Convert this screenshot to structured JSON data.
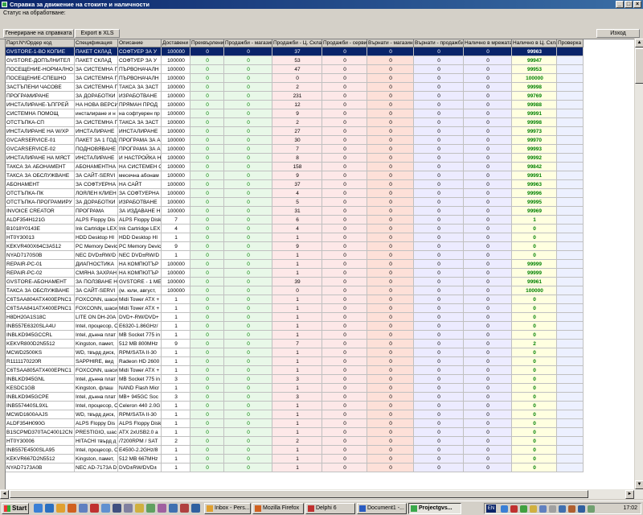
{
  "window": {
    "title": "Справка за движение на стоките и наличности",
    "status_label": "Статус на обработване:"
  },
  "toolbar": {
    "generate_label": "Генериране на справката",
    "export_label": "Export в XLS",
    "exit_label": "Изход"
  },
  "columns": [
    "Парт.N*/Ордер код",
    "Спецификация",
    "Описание",
    "Доставени",
    "Прехвърлени",
    "Продажби - магазини",
    "Продажби - Ц. Склад",
    "Продажби - сервиз",
    "Върнати - магазини",
    "Върнати - продажби",
    "Налично в мрежата",
    "Налично в Ц. Склад",
    "Проверка"
  ],
  "rows": [
    [
      "GVSTORE-1-ВО КОПИЕ",
      "ПАКЕТ СКЛАД",
      "СОФТУЕР ЗА У",
      "100000",
      "0",
      "0",
      "37",
      "0",
      "0",
      "0",
      "0",
      "99963",
      ""
    ],
    [
      "GVSTORE-ДОПЪЛНИТЕЛ",
      "ПАКЕТ СКЛАД",
      "СОФТУЕР ЗА У",
      "100000",
      "0",
      "0",
      "53",
      "0",
      "0",
      "0",
      "0",
      "99947",
      ""
    ],
    [
      "ПОСЕЩЕНИЕ-НОРМАЛНО",
      "ЗА СИСТЕМНА П",
      "ПЪРВОНАЧАЛН",
      "100000",
      "0",
      "0",
      "47",
      "0",
      "0",
      "0",
      "0",
      "99953",
      ""
    ],
    [
      "ПОСЕЩЕНИЕ-СПЕШНО",
      "ЗА СИСТЕМНА П",
      "ПЪРВОНАЧАЛН",
      "100000",
      "0",
      "0",
      "0",
      "0",
      "0",
      "0",
      "0",
      "100000",
      ""
    ],
    [
      "ЗАСТЪПЕНИ ЧАСОВЕ",
      "ЗА СИСТЕМНА П",
      "ТАКСА ЗА ЗАСТ",
      "100000",
      "0",
      "0",
      "2",
      "0",
      "0",
      "0",
      "0",
      "99998",
      ""
    ],
    [
      "ПРОГРАМИРАНЕ",
      "ЗА ДОРАБОТКИ",
      "ИЗРАБОТВАНЕ",
      "100000",
      "0",
      "0",
      "231",
      "0",
      "0",
      "0",
      "0",
      "99769",
      ""
    ],
    [
      "ИНСТАЛИРАНЕ-ЪПГРЕЙ",
      "НА НОВА ВЕРСИ",
      "ПРЯМАН ПРОД",
      "100000",
      "0",
      "0",
      "12",
      "0",
      "0",
      "0",
      "0",
      "99988",
      ""
    ],
    [
      "СИСТЕМНА ПОМОЩ",
      "инсталиране и н",
      "на софтуерен пр",
      "100000",
      "0",
      "0",
      "9",
      "0",
      "0",
      "0",
      "0",
      "99991",
      ""
    ],
    [
      "ОТСТЪПКА-СП",
      "ЗА СИСТЕМНА П",
      "ТАКСА ЗА ЗАСТ",
      "100000",
      "0",
      "0",
      "2",
      "0",
      "0",
      "0",
      "0",
      "99998",
      ""
    ],
    [
      "ИНСТАЛИРАНЕ НА W/XP",
      "ИНСТАЛИРАНЕ",
      "ИНСТАЛИРАНЕ",
      "100000",
      "0",
      "0",
      "27",
      "0",
      "0",
      "0",
      "0",
      "99973",
      ""
    ],
    [
      "GVCARSERVICE-01",
      "ПАКЕТ ЗА 1 ГОД",
      "ПРОГРАМА ЗА А",
      "100000",
      "0",
      "0",
      "30",
      "0",
      "0",
      "0",
      "0",
      "99970",
      ""
    ],
    [
      "GVCARSERVICE-02",
      "ПОДНОВЯВАНЕ",
      "ПРОГРАМА ЗА А",
      "100000",
      "0",
      "0",
      "7",
      "0",
      "0",
      "0",
      "0",
      "99993",
      ""
    ],
    [
      "ИНСТАЛИРАНЕ НА МЯСТ",
      "ИНСТАЛИРАНЕ",
      "И НАСТРОЙКА Н",
      "100000",
      "0",
      "0",
      "8",
      "0",
      "0",
      "0",
      "0",
      "99992",
      ""
    ],
    [
      "ТАКСА ЗА АБОНАМЕНТ",
      "АБОНАМЕНТНА",
      "НА СИСТЕМЕН С",
      "100000",
      "0",
      "0",
      "158",
      "0",
      "0",
      "0",
      "0",
      "99842",
      ""
    ],
    [
      "ТАКСА ЗА ОБСЛУЖВАНЕ",
      "ЗА САЙТ-SERVI",
      "месечна абонам",
      "100000",
      "0",
      "0",
      "9",
      "0",
      "0",
      "0",
      "0",
      "99991",
      ""
    ],
    [
      "АБОНАМЕНТ",
      "ЗА СОФТУЕРНА",
      "НА САЙТ",
      "100000",
      "0",
      "0",
      "37",
      "0",
      "0",
      "0",
      "0",
      "99963",
      ""
    ],
    [
      "ОТСТЪПКА-ПК",
      "ЛОЯЛЕН КЛИЕН",
      "ЗА СОФТУЕРНА",
      "100000",
      "0",
      "0",
      "4",
      "0",
      "0",
      "0",
      "0",
      "99996",
      ""
    ],
    [
      "ОТСТЪПКА-ПРОГРАМИРУ",
      "ЗА ДОРАБОТКИ",
      "ИЗРАБОТВАНЕ",
      "100000",
      "0",
      "0",
      "5",
      "0",
      "0",
      "0",
      "0",
      "99995",
      ""
    ],
    [
      "INVOICE CREATOR",
      "ПРОГРАМА",
      "ЗА ИЗДАВАНЕ Н",
      "100000",
      "0",
      "0",
      "31",
      "0",
      "0",
      "0",
      "0",
      "99969",
      ""
    ],
    [
      "ALDF354H121G",
      "ALPS Floppy Dis",
      "ALPS Floppy Disk",
      "7",
      "0",
      "0",
      "6",
      "0",
      "0",
      "0",
      "0",
      "1",
      ""
    ],
    [
      "B1018Y0143E",
      "Ink Cartridge LEX",
      "Ink Cartridge LEX",
      "4",
      "0",
      "0",
      "4",
      "0",
      "0",
      "0",
      "0",
      "0",
      ""
    ],
    [
      "HT0Y30013",
      "HDD Desktop HI",
      "HDD Desktop HI",
      "1",
      "0",
      "0",
      "1",
      "0",
      "0",
      "0",
      "0",
      "0",
      ""
    ],
    [
      "KEKVR400X64C3A512",
      "PC Memory Devic",
      "PC Memory Devic",
      "9",
      "0",
      "0",
      "9",
      "0",
      "0",
      "0",
      "0",
      "0",
      ""
    ],
    [
      "NYAD7170S0B",
      "NEC DVD±RW/D",
      "NEC DVD±RW/D",
      "1",
      "0",
      "0",
      "1",
      "0",
      "0",
      "0",
      "0",
      "0",
      ""
    ],
    [
      "REPAIR-PC-01",
      "ДИАГНОСТИКА",
      "НА КОМПЮТЪР",
      "100000",
      "0",
      "0",
      "1",
      "0",
      "0",
      "0",
      "0",
      "99999",
      ""
    ],
    [
      "REPAIR-PC-02",
      "СМЯНА ЗАХРАН",
      "НА КОМПЮТЪР",
      "100000",
      "0",
      "0",
      "1",
      "0",
      "0",
      "0",
      "0",
      "99999",
      ""
    ],
    [
      "GVSTORE-АБОНАМЕНТ",
      "ЗА ПОЛЗВАНЕ Н",
      "GVSTORE - 1 МЕ",
      "100000",
      "0",
      "0",
      "39",
      "0",
      "0",
      "0",
      "0",
      "99961",
      ""
    ],
    [
      "ТАКСА ЗА ОБСЛУЖВАНЕ",
      "ЗА САЙТ-SERVI",
      "(м. юли, август,",
      "100000",
      "0",
      "0",
      "0",
      "0",
      "0",
      "0",
      "0",
      "100000",
      ""
    ],
    [
      "C6TSAA804ATX400EPNC1",
      "FOXCONN, шаси",
      "Midi Tower ATX +",
      "1",
      "0",
      "0",
      "1",
      "0",
      "0",
      "0",
      "0",
      "0",
      ""
    ],
    [
      "C6TSAA841ATX400EPNC1",
      "FOXCONN, шаси",
      "Midi Tower ATX +",
      "1",
      "0",
      "0",
      "1",
      "0",
      "0",
      "0",
      "0",
      "0",
      ""
    ],
    [
      "H8DH20A1S18C",
      "LITE ON DH-20A",
      "DVD+-RW/DVD+",
      "1",
      "0",
      "0",
      "1",
      "0",
      "0",
      "0",
      "0",
      "0",
      ""
    ],
    [
      "INB557E6320SLA4U",
      "Intel, процесор, C",
      "E6320-1.86GHz/",
      "1",
      "0",
      "0",
      "1",
      "0",
      "0",
      "0",
      "0",
      "0",
      ""
    ],
    [
      "INBLKD945GCCRL",
      "Intel, дънна плат",
      "MB Socket 775 in",
      "1",
      "0",
      "0",
      "1",
      "0",
      "0",
      "0",
      "0",
      "0",
      ""
    ],
    [
      "KEKVR800D2N5512",
      "Kingston, памет,",
      "512 MB 800MHz",
      "9",
      "0",
      "0",
      "7",
      "0",
      "0",
      "0",
      "0",
      "2",
      ""
    ],
    [
      "MCWD2500KS",
      "WD, твърд диск,",
      "RPM/SATA II-30",
      "1",
      "0",
      "0",
      "1",
      "0",
      "0",
      "0",
      "0",
      "0",
      ""
    ],
    [
      "R1111170220R",
      "SAPPHIRE, вид",
      "Radeon HD 2600",
      "1",
      "0",
      "0",
      "1",
      "0",
      "0",
      "0",
      "0",
      "0",
      ""
    ],
    [
      "C6TSAA805ATX400EPNC1",
      "FOXCONN, шаси",
      "Midi Tower ATX +",
      "1",
      "0",
      "0",
      "1",
      "0",
      "0",
      "0",
      "0",
      "0",
      ""
    ],
    [
      "INBLKD945GNL",
      "Intel, дънна плат",
      "MB Socket 775 in",
      "3",
      "0",
      "0",
      "3",
      "0",
      "0",
      "0",
      "0",
      "0",
      ""
    ],
    [
      "KESDC1GB",
      "Kingston, флаш",
      "NAND Flash Micr",
      "1",
      "0",
      "0",
      "1",
      "0",
      "0",
      "0",
      "0",
      "0",
      ""
    ],
    [
      "INBLKD945GCPE",
      "Intel, дънна плат",
      "MB+ 945GC Soc",
      "3",
      "0",
      "0",
      "3",
      "0",
      "0",
      "0",
      "0",
      "0",
      ""
    ],
    [
      "INB557440SL9XL",
      "Intel, процесор, C",
      "Celeron 440 2.0G",
      "1",
      "0",
      "0",
      "1",
      "0",
      "0",
      "0",
      "0",
      "0",
      ""
    ],
    [
      "MCWD1600AAJS",
      "WD, твърд диск,",
      "RPM/SATA II-30",
      "1",
      "0",
      "0",
      "1",
      "0",
      "0",
      "0",
      "0",
      "0",
      ""
    ],
    [
      "ALDF354H090G",
      "ALPS Floppy Dis",
      "ALPS Floppy Disk",
      "1",
      "0",
      "0",
      "1",
      "0",
      "0",
      "0",
      "0",
      "0",
      ""
    ],
    [
      "B1SCPMD370TAC40012CN",
      "PRESTIGIO, шас",
      "ATX 2xUSB2.0 a",
      "1",
      "0",
      "0",
      "1",
      "0",
      "0",
      "0",
      "0",
      "0",
      ""
    ],
    [
      "HT0Y30006",
      "HITACHI твърд д",
      "/7200RPM / SAT",
      "2",
      "0",
      "0",
      "2",
      "0",
      "0",
      "0",
      "0",
      "0",
      ""
    ],
    [
      "INB557E4500SLA95",
      "Intel, процесор, C",
      "E4500-2.2GHz/8",
      "1",
      "0",
      "0",
      "1",
      "0",
      "0",
      "0",
      "0",
      "0",
      ""
    ],
    [
      "KEKVR667D2N5512",
      "Kingston, памет,",
      "512 MB 667MHz",
      "1",
      "0",
      "0",
      "1",
      "0",
      "0",
      "0",
      "0",
      "0",
      ""
    ],
    [
      "NYAD7173A0B",
      "NEC AD-7173A D",
      "DVD±RW/DVD±",
      "1",
      "0",
      "0",
      "1",
      "0",
      "0",
      "0",
      "0",
      "0",
      ""
    ]
  ],
  "taskbar": {
    "start_label": "Start",
    "tasks": [
      "Inbox - Pers...",
      "Mozilla Firefox",
      "Delphi 6",
      "Document1 -...",
      "Projectgvs..."
    ],
    "lang": "EN",
    "clock": "17:02"
  }
}
